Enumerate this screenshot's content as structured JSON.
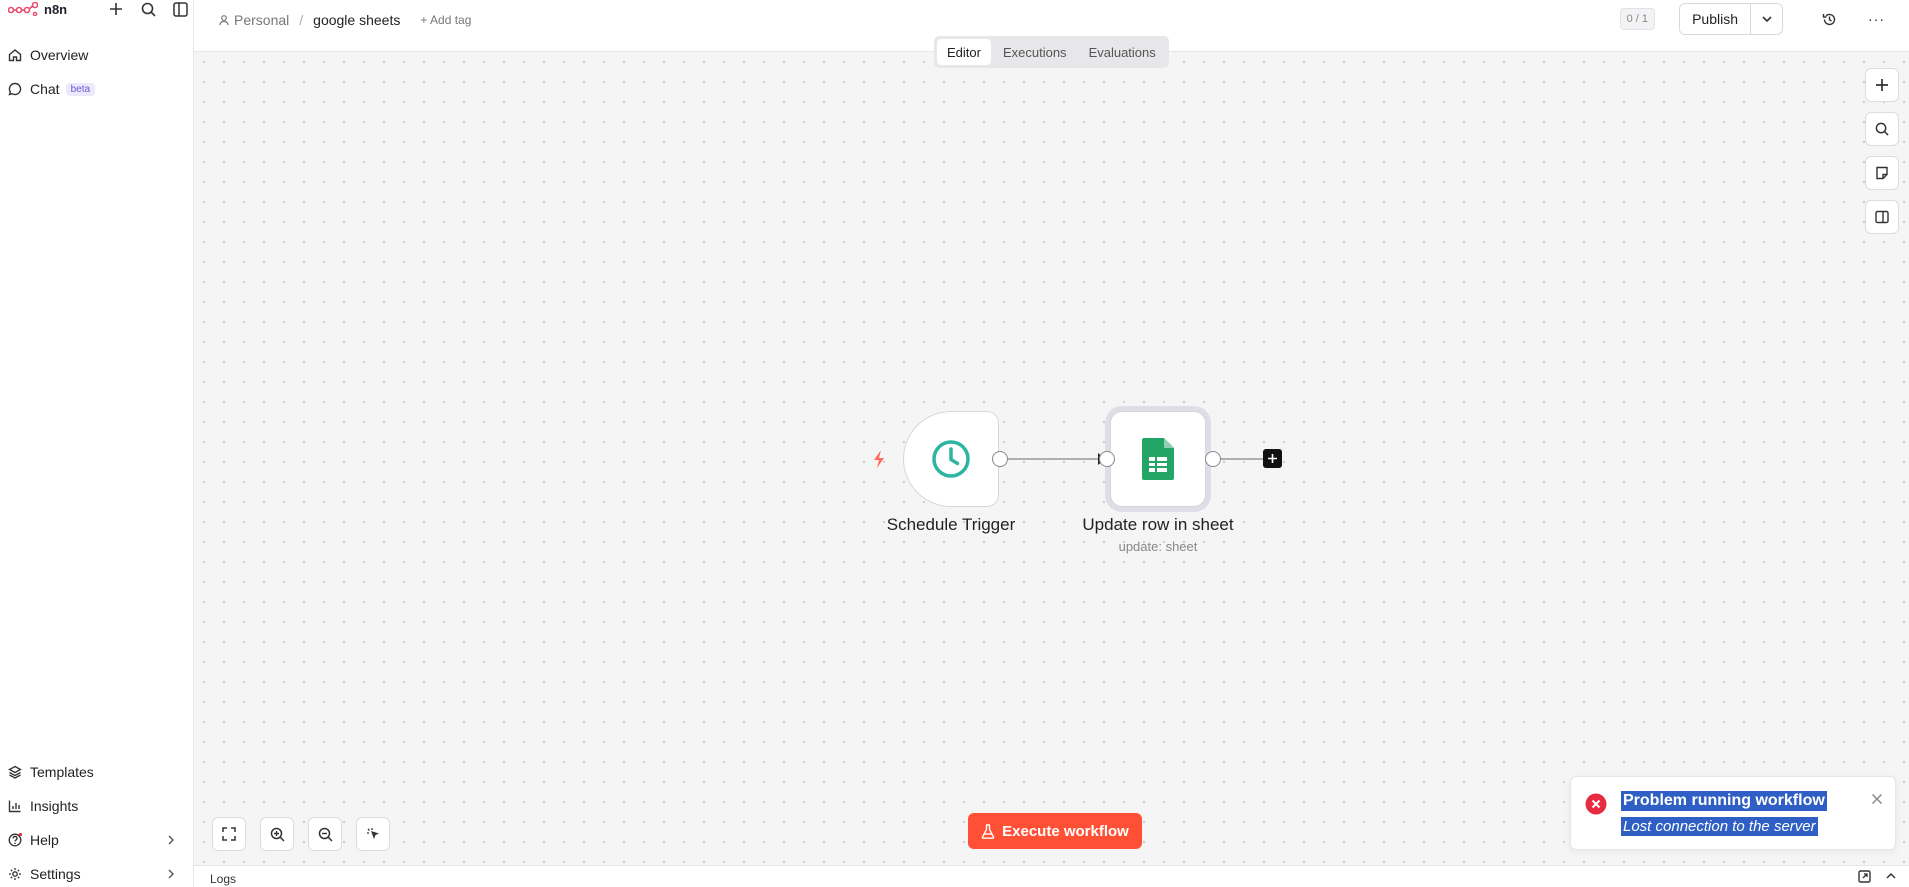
{
  "sidebar": {
    "brand": "n8n",
    "nav_top": [
      {
        "label": "Overview",
        "icon": "home-icon"
      },
      {
        "label": "Chat",
        "badge": "beta",
        "icon": "chat-icon"
      }
    ],
    "nav_bottom": [
      {
        "label": "Templates",
        "icon": "templates-icon"
      },
      {
        "label": "Insights",
        "icon": "insights-icon"
      },
      {
        "label": "Help",
        "icon": "help-icon"
      },
      {
        "label": "Settings",
        "icon": "settings-icon"
      }
    ]
  },
  "header": {
    "breadcrumb_project": "Personal",
    "breadcrumb_sep": "/",
    "workflow_name": "google sheets",
    "add_tag": "+ Add tag",
    "counter": "0 / 1",
    "publish_label": "Publish",
    "more_label": "···"
  },
  "tabs": [
    {
      "label": "Editor",
      "active": true
    },
    {
      "label": "Executions",
      "active": false
    },
    {
      "label": "Evaluations",
      "active": false
    }
  ],
  "nodes": {
    "trigger": {
      "label": "Schedule Trigger",
      "icon": "clock-icon"
    },
    "sheets": {
      "label": "Update row in sheet",
      "subtitle": "update: sheet",
      "icon": "google-sheets-icon"
    }
  },
  "execute_label": "Execute workflow",
  "toast": {
    "title": "Problem running workflow",
    "message": "Lost connection to the server"
  },
  "logs_label": "Logs",
  "colors": {
    "accent": "#ff5035",
    "error": "#e52d3f",
    "sheets_green": "#23a566",
    "clock_teal": "#2cb5a0",
    "selection": "#2f5fc4"
  }
}
